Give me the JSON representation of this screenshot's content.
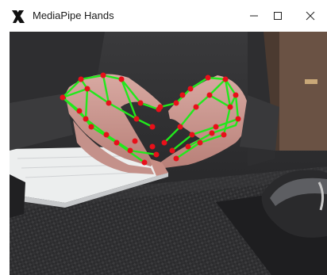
{
  "window": {
    "title": "MediaPipe Hands",
    "icon": "mediapipe-x-icon",
    "controls": {
      "minimize_icon": "minimize-icon",
      "maximize_icon": "maximize-icon",
      "close_icon": "close-icon"
    }
  },
  "viewport": {
    "content": "camera-feed",
    "landmark_color": "#e8101a",
    "connection_color": "#22e81c"
  }
}
